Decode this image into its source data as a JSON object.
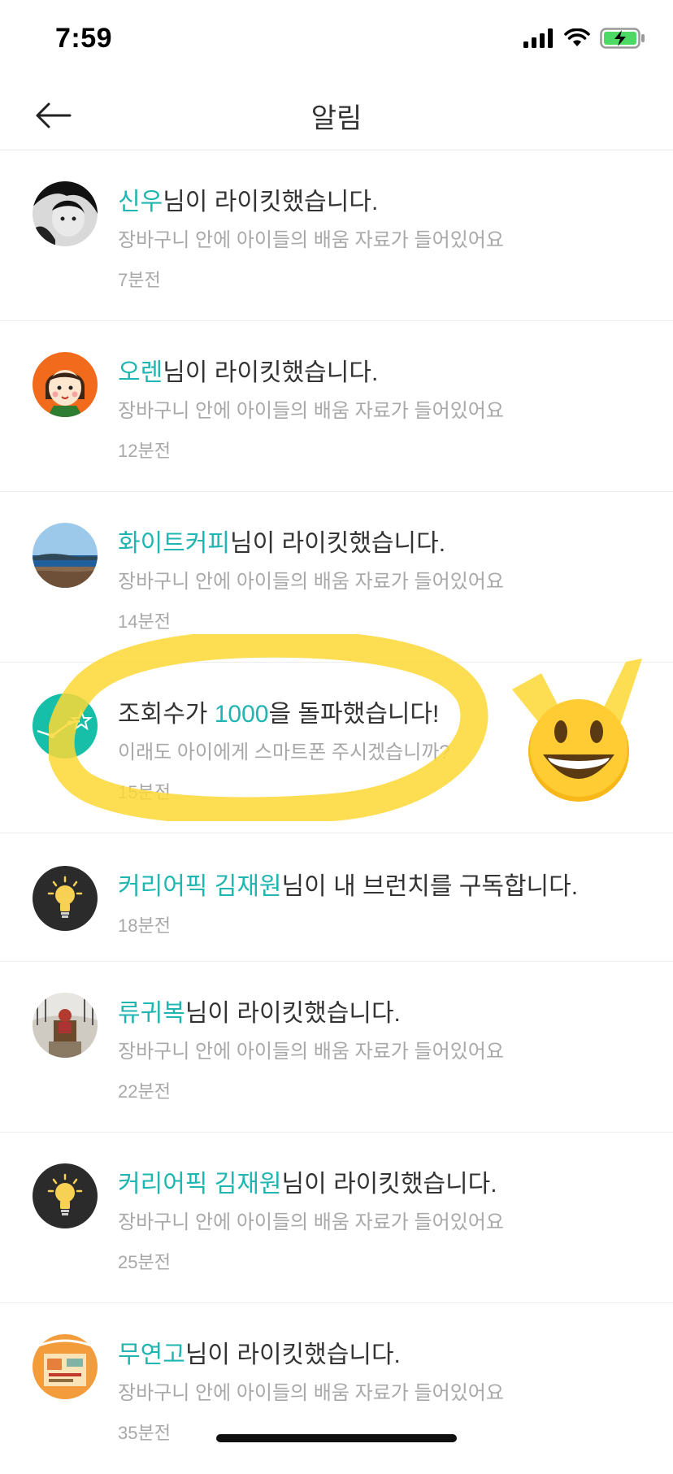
{
  "status_bar": {
    "time": "7:59"
  },
  "header": {
    "title": "알림"
  },
  "notifications": [
    {
      "name": "신우",
      "action": "님이 라이킷했습니다.",
      "subtitle": "장바구니 안에 아이들의 배움 자료가 들어있어요",
      "time": "7분전"
    },
    {
      "name": "오렌",
      "action": "님이 라이킷했습니다.",
      "subtitle": "장바구니 안에 아이들의 배움 자료가 들어있어요",
      "time": "12분전"
    },
    {
      "name": "화이트커피",
      "action": "님이 라이킷했습니다.",
      "subtitle": "장바구니 안에 아이들의 배움 자료가 들어있어요",
      "time": "14분전"
    },
    {
      "prefix": "조회수가 ",
      "count": "1000",
      "suffix": "을 돌파했습니다!",
      "subtitle": "이래도 아이에게 스마트폰 주시겠습니까?",
      "time": "15분전"
    },
    {
      "name": "커리어픽 김재원",
      "action": "님이 내 브런치를 구독합니다.",
      "time": "18분전"
    },
    {
      "name": "류귀복",
      "action": "님이 라이킷했습니다.",
      "subtitle": "장바구니 안에 아이들의 배움 자료가 들어있어요",
      "time": "22분전"
    },
    {
      "name": "커리어픽 김재원",
      "action": "님이 라이킷했습니다.",
      "subtitle": "장바구니 안에 아이들의 배움 자료가 들어있어요",
      "time": "25분전"
    },
    {
      "name": "무연고",
      "action": "님이 라이킷했습니다.",
      "subtitle": "장바구니 안에 아이들의 배움 자료가 들어있어요",
      "time": "35분전"
    }
  ],
  "icons": {
    "back": "arrow-left-icon",
    "signal": "cellular-signal-icon",
    "wifi": "wifi-icon",
    "battery": "battery-charging-icon",
    "stats": "stats-chart-icon",
    "bulb": "lightbulb-icon",
    "emoji": "grinning-face-emoji"
  },
  "colors": {
    "accent": "#1fb5b0",
    "highlight": "#fdd835",
    "battery": "#4cd964"
  }
}
